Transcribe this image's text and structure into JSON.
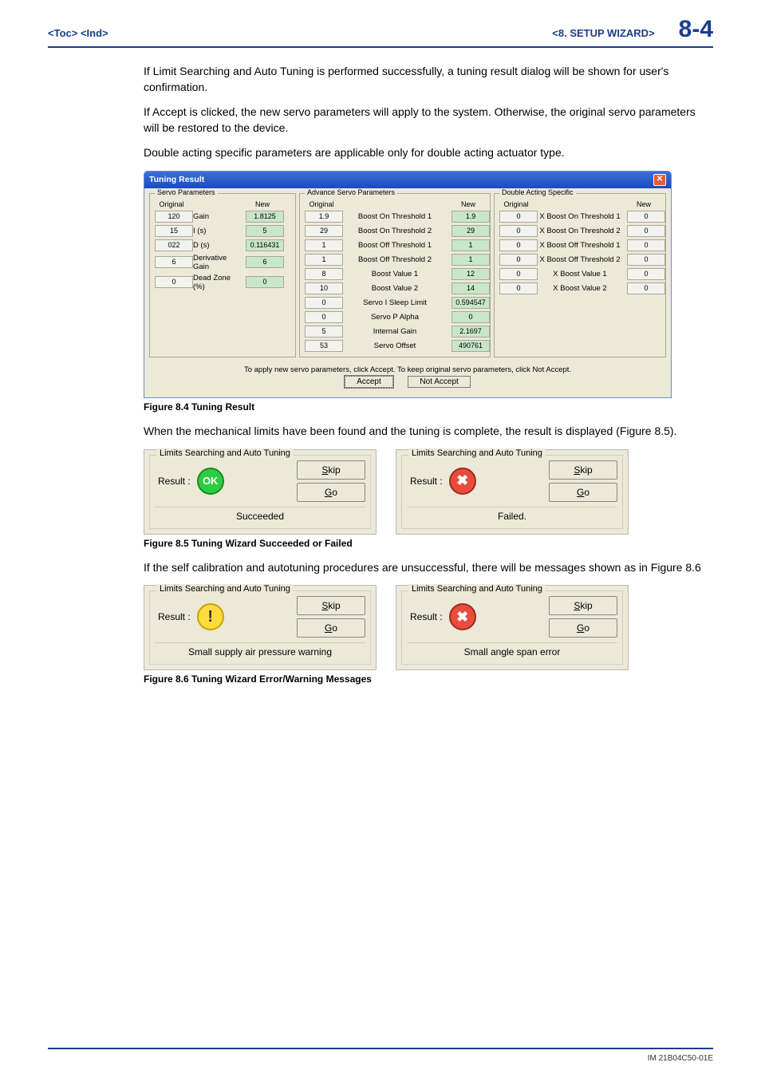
{
  "header": {
    "left": "<Toc> <Ind>",
    "section": "<8.  SETUP WIZARD>",
    "page": "8-4"
  },
  "paragraphs": {
    "p1": "If Limit Searching and Auto Tuning  is performed successfully, a tuning result dialog will be shown for user's confirmation.",
    "p2": "If Accept is clicked, the new servo parameters will apply to the system. Otherwise, the original servo parameters will be restored to the device.",
    "p3": "Double acting specific parameters are applicable only for double acting actuator type.",
    "p4": "When the mechanical limits have been found and the tuning is complete, the result is displayed (Figure 8.5).",
    "p5": "If the self calibration and autotuning procedures are unsuccessful, there will be messages shown as in Figure 8.6"
  },
  "captions": {
    "fig84": "Figure 8.4  Tuning Result",
    "fig85": "Figure 8.5  Tuning Wizard Succeeded or Failed",
    "fig86": "Figure 8.6 Tuning Wizard Error/Warning Messages"
  },
  "dialog": {
    "title": "Tuning Result",
    "servo": {
      "title": "Servo Parameters",
      "original": "Original",
      "new": "New",
      "gain_label": "Gain",
      "gain_orig": "120",
      "gain_new": "1.8125",
      "i_label": "I  (s)",
      "i_orig": "15",
      "i_new": "5",
      "d_label": "D  (s)",
      "d_orig": "022",
      "d_new": "0.116431",
      "deriv_label": "Derivative Gain",
      "deriv_orig": "6",
      "deriv_new": "6",
      "dead_label": "Dead Zone  (%)",
      "dead_orig": "0",
      "dead_new": "0"
    },
    "advance": {
      "title": "Advance Servo Parameters",
      "original": "Original",
      "new": "New",
      "rows": [
        {
          "label": "Boost On Threshold 1",
          "orig": "1.9",
          "new": "1.9"
        },
        {
          "label": "Boost On Threshold 2",
          "orig": "29",
          "new": "29"
        },
        {
          "label": "Boost Off Threshold 1",
          "orig": "1",
          "new": "1"
        },
        {
          "label": "Boost Off Threshold 2",
          "orig": "1",
          "new": "1"
        },
        {
          "label": "Boost Value 1",
          "orig": "8",
          "new": "12"
        },
        {
          "label": "Boost Value 2",
          "orig": "10",
          "new": "14"
        },
        {
          "label": "Servo I Sleep Limit",
          "orig": "0",
          "new": "0.594547"
        },
        {
          "label": "Servo P Alpha",
          "orig": "0",
          "new": "0"
        },
        {
          "label": "Internal Gain",
          "orig": "5",
          "new": "2.1697"
        },
        {
          "label": "Servo Offset",
          "orig": "53",
          "new": "490761"
        }
      ]
    },
    "double": {
      "title": "Double Acting Specific",
      "original": "Original",
      "new": "New",
      "rows": [
        {
          "label": "X Boost On Threshold 1",
          "orig": "0",
          "new": "0"
        },
        {
          "label": "X Boost On Threshold 2",
          "orig": "0",
          "new": "0"
        },
        {
          "label": "X Boost Off Threshold 1",
          "orig": "0",
          "new": "0"
        },
        {
          "label": "X Boost Off Threshold 2",
          "orig": "0",
          "new": "0"
        },
        {
          "label": "X Boost Value 1",
          "orig": "0",
          "new": "0"
        },
        {
          "label": "X Boost Value 2",
          "orig": "0",
          "new": "0"
        }
      ]
    },
    "footer_text": "To apply new servo parameters, click Accept. To keep original servo parameters, click Not Accept.",
    "accept": "Accept",
    "not_accept": "Not Accept"
  },
  "status": {
    "group_title": "Limits Searching and Auto Tuning",
    "result_label": "Result :",
    "skip": "Skip",
    "go": "Go",
    "ok_icon": "OK",
    "succeeded": "Succeeded",
    "failed": "Failed.",
    "warn_msg": "Small supply air pressure warning",
    "error_msg": "Small angle span error"
  },
  "footer": "IM 21B04C50-01E"
}
